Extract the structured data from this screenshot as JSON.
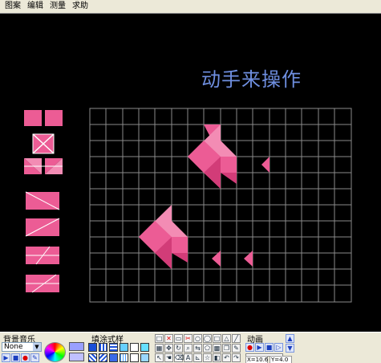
{
  "menu": [
    "图案",
    "编辑",
    "测量",
    "求助"
  ],
  "heading": "动手来操作",
  "colors": {
    "shape": "#ec5c95",
    "shape_light": "#f38cb4",
    "shape_dark": "#d23c78",
    "grid": "#8a8a8a",
    "heading": "#6f8fe0"
  },
  "bottom": {
    "music_label": "背景音乐",
    "music_value": "None",
    "fill_label": "填涂式样",
    "animation_label": "动画",
    "coord_x": "X=10.6",
    "coord_y": "Y=4.0"
  }
}
